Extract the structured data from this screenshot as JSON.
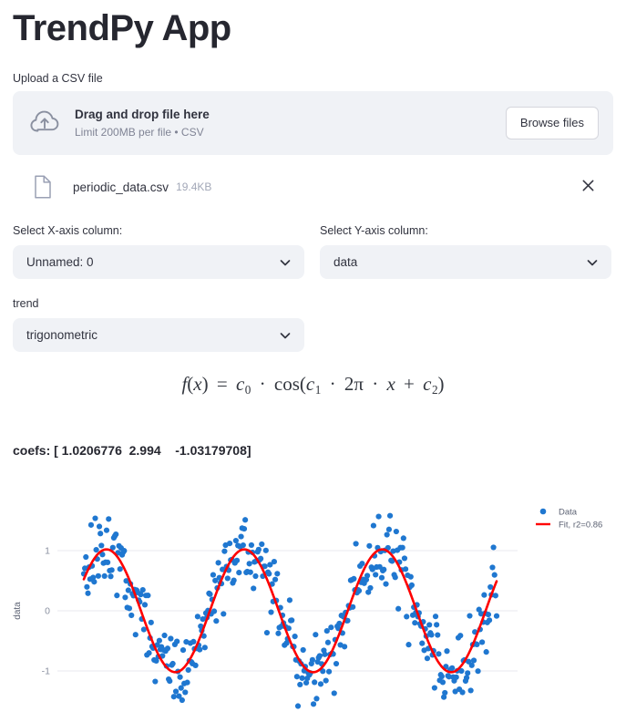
{
  "app": {
    "title": "TrendPy App"
  },
  "uploader": {
    "label": "Upload a CSV file",
    "drop_title": "Drag and drop file here",
    "drop_limits": "Limit 200MB per file • CSV",
    "browse_label": "Browse files",
    "icon": "cloud-upload-icon",
    "file": {
      "icon": "file-document-icon",
      "name": "periodic_data.csv",
      "size": "19.4KB",
      "remove_icon": "close-icon"
    }
  },
  "controls": {
    "x_axis": {
      "label": "Select X-axis column:",
      "value": "Unnamed: 0",
      "chevron": "chevron-down-icon"
    },
    "y_axis": {
      "label": "Select Y-axis column:",
      "value": "data",
      "chevron": "chevron-down-icon"
    },
    "trend": {
      "label": "trend",
      "value": "trigonometric",
      "chevron": "chevron-down-icon"
    }
  },
  "formula": {
    "latex": "f(x) = c_0 \\cdot \\cos(c_1 \\cdot 2\\pi \\cdot x + c_2)",
    "parts": {
      "fx": "f",
      "var": "x",
      "eq": "=",
      "c0": "c",
      "c0sub": "0",
      "dot": "·",
      "cos": "cos",
      "c1": "c",
      "c1sub": "1",
      "two_pi": "2π",
      "plus": "+",
      "c2": "c",
      "c2sub": "2"
    }
  },
  "coefficients": {
    "prefix": "coefs:",
    "text": "coefs: [ 1.0206776  2.994    -1.03179708]",
    "values": [
      1.0206776,
      2.994,
      -1.03179708
    ]
  },
  "chart_data": {
    "type": "scatter",
    "title": "",
    "xlabel": "",
    "ylabel": "data",
    "ylim": [
      -1.9,
      1.75
    ],
    "xlim": [
      0,
      1
    ],
    "yticks": [
      1,
      0,
      -1
    ],
    "ytick_labels": [
      "1",
      "0",
      "-1"
    ],
    "grid": true,
    "legend_position": "upper right",
    "series": [
      {
        "name": "Data",
        "type": "scatter",
        "color": "#1f77d0",
        "marker": "circle",
        "n_points": 400,
        "noise_std": 0.3
      },
      {
        "name": "Fit, r2=0.86",
        "type": "line",
        "color": "#ff0000",
        "fit": {
          "form": "c0 * cos(c1 * 2pi * x + c2)",
          "c0": 1.0206776,
          "c1": 2.994,
          "c2": -1.03179708,
          "r2": 0.86
        }
      }
    ],
    "legend": [
      {
        "label": "Data",
        "color": "#1f77d0",
        "marker": "circle"
      },
      {
        "label": "Fit, r2=0.86",
        "color": "#ff0000",
        "marker": "line"
      }
    ]
  }
}
